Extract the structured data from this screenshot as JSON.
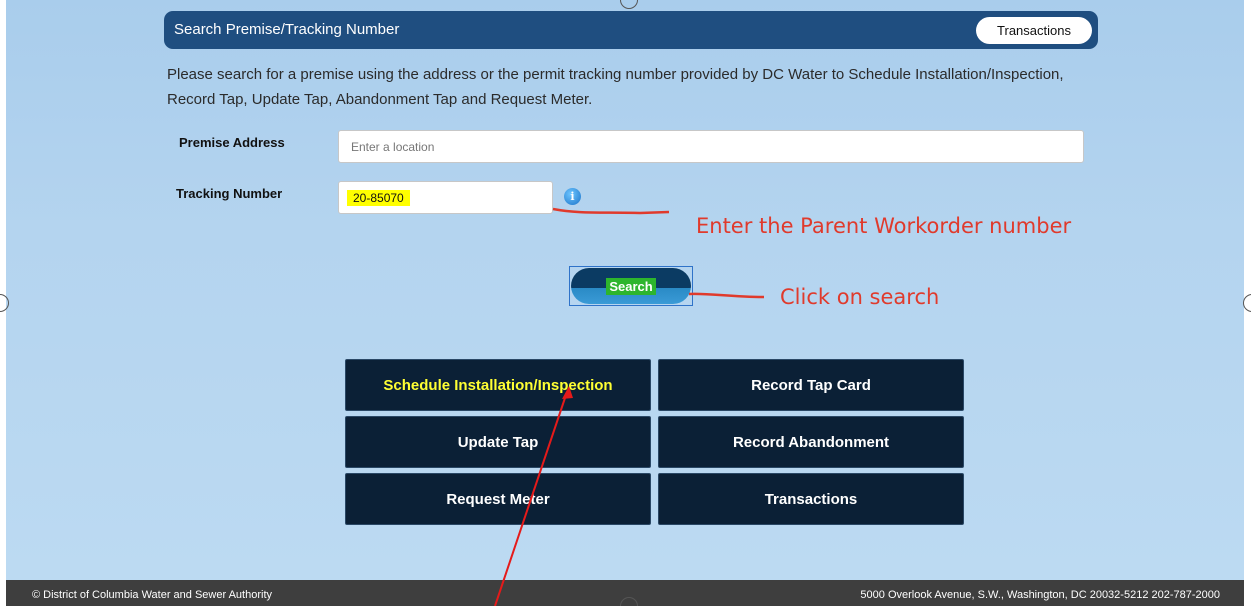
{
  "header": {
    "title": "Search Premise/Tracking Number",
    "transactions_button": "Transactions"
  },
  "intro_text": "Please search for a premise using the address or the permit tracking number provided by DC Water to Schedule Installation/Inspection, Record Tap, Update Tap, Abandonment Tap and Request Meter.",
  "form": {
    "premise_label": "Premise Address",
    "premise_placeholder": "Enter a location",
    "tracking_label": "Tracking Number",
    "tracking_value": "20-85070",
    "info_icon": "info-icon"
  },
  "search_button": "Search",
  "annotations": {
    "tracking_note": "Enter the Parent Workorder number",
    "search_note": "Click on search",
    "color": "#e03a2c"
  },
  "actions": [
    {
      "label": "Schedule Installation/Inspection",
      "highlighted": true
    },
    {
      "label": "Record Tap Card"
    },
    {
      "label": "Update Tap"
    },
    {
      "label": "Record Abandonment"
    },
    {
      "label": "Request Meter"
    },
    {
      "label": "Transactions"
    }
  ],
  "footer": {
    "copyright": "© District of Columbia Water and Sewer Authority",
    "address": "5000 Overlook Avenue, S.W., Washington, DC 20032-5212 202-787-2000"
  },
  "colors": {
    "header_bg": "#1f4e80",
    "action_bg": "#0b2036",
    "highlight_text": "#ffff33",
    "highlight_bg": "#ffff00"
  }
}
